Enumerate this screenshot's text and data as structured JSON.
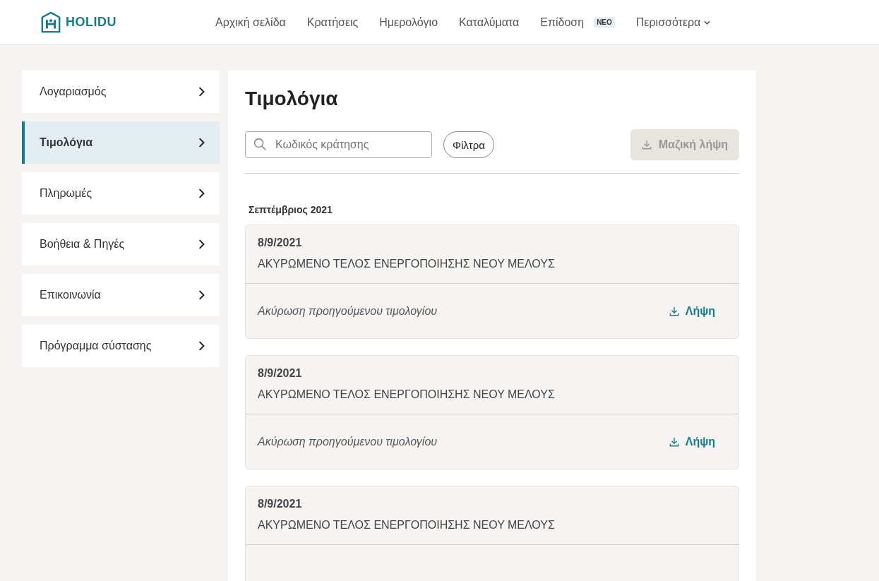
{
  "header": {
    "logo": "HOLIDU",
    "nav": [
      {
        "label": "Αρχική σελίδα",
        "selected": false
      },
      {
        "label": "Κρατήσεις",
        "selected": false
      },
      {
        "label": "Ημερολόγιο",
        "selected": false
      },
      {
        "label": "Καταλύματα",
        "selected": false
      },
      {
        "label": "Επίδοση",
        "selected": false,
        "badge": "ΝΕΟ"
      },
      {
        "label": "Περισσότερα",
        "selected": false,
        "dropdown": true
      }
    ]
  },
  "sidebar": {
    "items": [
      {
        "label": "Λογαριασμός",
        "selected": false
      },
      {
        "label": "Τιμολόγια",
        "selected": true
      },
      {
        "label": "Πληρωμές",
        "selected": false
      },
      {
        "label": "Βοήθεια & Πηγές",
        "selected": false
      },
      {
        "label": "Επικοινωνία",
        "selected": false
      },
      {
        "label": "Πρόγραμμα σύστασης",
        "selected": false
      }
    ]
  },
  "main": {
    "title": "Τιμολόγια",
    "search": {
      "placeholder": "Κωδικός κράτησης"
    },
    "filter_button": "Φίλτρα",
    "bulk_download": {
      "label": "Μαζική λήψη",
      "disabled": true
    },
    "groups": [
      {
        "month": "Σεπτέμβριος 2021",
        "invoices": [
          {
            "date": "8/9/2021",
            "title": "ΑΚΥΡΩΜΕΝΟ ΤΕΛΟΣ ΕΝΕΡΓΟΠΟΙΗΣΗΣ ΝΕΟΥ ΜΕΛΟΥΣ",
            "note": "Ακύρωση προηγούμενου τιμολογίου",
            "download": "Λήψη"
          },
          {
            "date": "8/9/2021",
            "title": "ΑΚΥΡΩΜΕΝΟ ΤΕΛΟΣ ΕΝΕΡΓΟΠΟΙΗΣΗΣ ΝΕΟΥ ΜΕΛΟΥΣ",
            "note": "Ακύρωση προηγούμενου τιμολογίου",
            "download": "Λήψη"
          },
          {
            "date": "8/9/2021",
            "title": "ΑΚΥΡΩΜΕΝΟ ΤΕΛΟΣ ΕΝΕΡΓΟΠΟΙΗΣΗΣ ΝΕΟΥ ΜΕΛΟΥΣ"
          }
        ]
      }
    ]
  }
}
